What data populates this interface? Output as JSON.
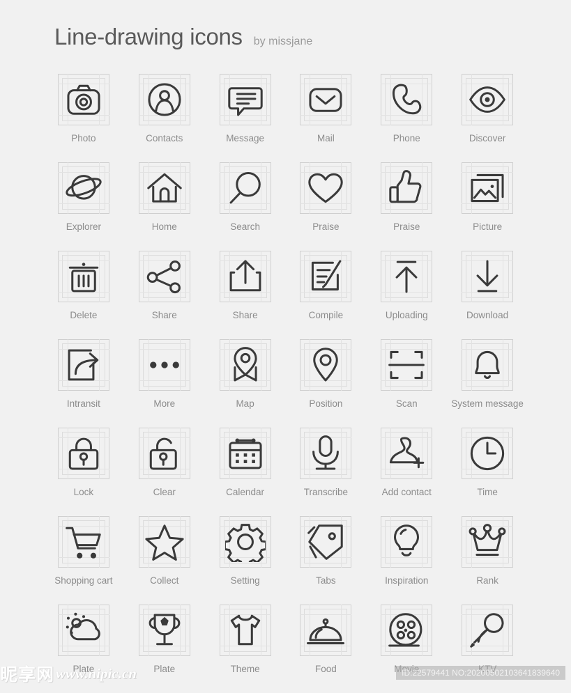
{
  "header": {
    "title": "Line-drawing icons",
    "byline": "by missjane"
  },
  "icons": [
    {
      "label": "Photo",
      "icon": "camera-icon"
    },
    {
      "label": "Contacts",
      "icon": "contacts-icon"
    },
    {
      "label": "Message",
      "icon": "message-bubble-icon"
    },
    {
      "label": "Mail",
      "icon": "mail-envelope-icon"
    },
    {
      "label": "Phone",
      "icon": "phone-handset-icon"
    },
    {
      "label": "Discover",
      "icon": "eye-icon"
    },
    {
      "label": "Explorer",
      "icon": "planet-icon"
    },
    {
      "label": "Home",
      "icon": "home-icon"
    },
    {
      "label": "Search",
      "icon": "magnifier-icon"
    },
    {
      "label": "Praise",
      "icon": "heart-icon"
    },
    {
      "label": "Praise",
      "icon": "thumbs-up-icon"
    },
    {
      "label": "Picture",
      "icon": "picture-icon"
    },
    {
      "label": "Delete",
      "icon": "trash-icon"
    },
    {
      "label": "Share",
      "icon": "share-nodes-icon"
    },
    {
      "label": "Share",
      "icon": "share-upload-box-icon"
    },
    {
      "label": "Compile",
      "icon": "edit-document-icon"
    },
    {
      "label": "Uploading",
      "icon": "upload-arrow-icon"
    },
    {
      "label": "Download",
      "icon": "download-arrow-icon"
    },
    {
      "label": "Intransit",
      "icon": "forward-box-icon"
    },
    {
      "label": "More",
      "icon": "ellipsis-icon"
    },
    {
      "label": "Map",
      "icon": "map-pin-banner-icon"
    },
    {
      "label": "Position",
      "icon": "location-pin-icon"
    },
    {
      "label": "Scan",
      "icon": "scan-icon"
    },
    {
      "label": "System message",
      "icon": "bell-icon"
    },
    {
      "label": "Lock",
      "icon": "lock-closed-icon"
    },
    {
      "label": "Clear",
      "icon": "lock-open-icon"
    },
    {
      "label": "Calendar",
      "icon": "calendar-icon"
    },
    {
      "label": "Transcribe",
      "icon": "microphone-icon"
    },
    {
      "label": "Add contact",
      "icon": "add-contact-icon"
    },
    {
      "label": "Time",
      "icon": "clock-icon"
    },
    {
      "label": "Shopping cart",
      "icon": "shopping-cart-icon"
    },
    {
      "label": "Collect",
      "icon": "star-icon"
    },
    {
      "label": "Setting",
      "icon": "gear-icon"
    },
    {
      "label": "Tabs",
      "icon": "tag-icon"
    },
    {
      "label": "Inspiration",
      "icon": "lightbulb-icon"
    },
    {
      "label": "Rank",
      "icon": "crown-icon"
    },
    {
      "label": "Plate",
      "icon": "weather-cloud-sun-icon"
    },
    {
      "label": "Plate",
      "icon": "trophy-icon"
    },
    {
      "label": "Theme",
      "icon": "tshirt-icon"
    },
    {
      "label": "Food",
      "icon": "food-cloche-icon"
    },
    {
      "label": "Movie",
      "icon": "film-reel-icon"
    },
    {
      "label": "KTV",
      "icon": "microphone-handheld-icon"
    }
  ],
  "watermarks": {
    "site_cn": "昵享网",
    "site_url": "www.nipic.cn",
    "id_line": "ID:22579441 NO:20200502103641839640"
  },
  "colors": {
    "background": "#f1f1f1",
    "icon_stroke": "#3a3a3a",
    "label_text": "#8c8c8c",
    "title_text": "#5a5a5a",
    "grid_border": "#cfcfcf"
  }
}
